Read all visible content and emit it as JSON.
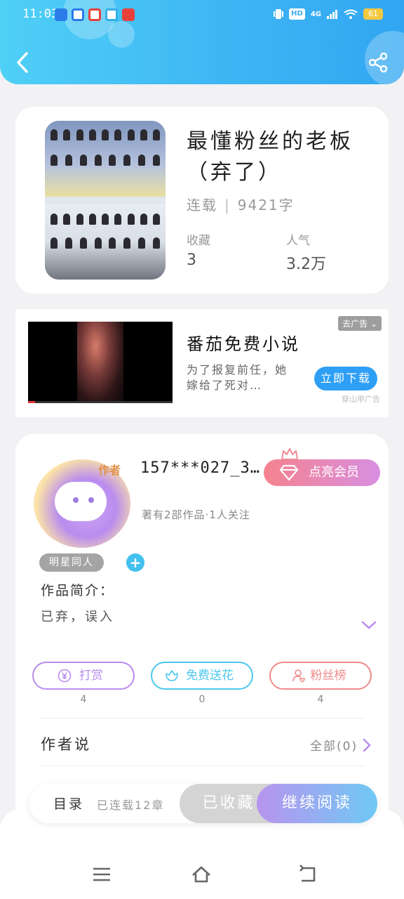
{
  "status_bar": {
    "time": "11:03",
    "network": "4G",
    "hd": "HD",
    "battery": "61"
  },
  "book": {
    "title": "最懂粉丝的老板（弃了）",
    "status": "连载",
    "word_count": "9421字",
    "stats": [
      {
        "label": "收藏",
        "value": "3"
      },
      {
        "label": "人气",
        "value": "3.2万"
      }
    ]
  },
  "ad": {
    "close_label": "去广告",
    "title": "番茄免费小说",
    "description": "为了报复前任，她嫁给了死对…",
    "button": "立即下载",
    "source": "穿山甲广告"
  },
  "author": {
    "avatar_tag": "作者",
    "name": "157***027_3…",
    "vip_button": "点亮会员",
    "info": "著有2部作品·1人关注",
    "tag": "明星同人",
    "plus": "+",
    "intro_label": "作品简介：",
    "intro_text": "已弃，误入"
  },
  "actions": [
    {
      "label": "打赏",
      "count": "4",
      "color": "#b98cef",
      "icon": "yen-coin-icon"
    },
    {
      "label": "免费送花",
      "count": "0",
      "color": "#4cc8ee",
      "icon": "flower-icon"
    },
    {
      "label": "粉丝榜",
      "count": "4",
      "color": "#f08a8a",
      "icon": "fan-user-icon"
    }
  ],
  "author_says": {
    "title": "作者说",
    "all": "全部(0)"
  },
  "bottom_bar": {
    "toc": "目录",
    "toc_sub": "已连载12章",
    "collected": "已收藏",
    "continue": "继续阅读"
  },
  "colors": {
    "header": "#3fb6f4",
    "accent_purple": "#b98cef",
    "accent_blue": "#42c1ee",
    "vip_pink": "#f5828f"
  }
}
